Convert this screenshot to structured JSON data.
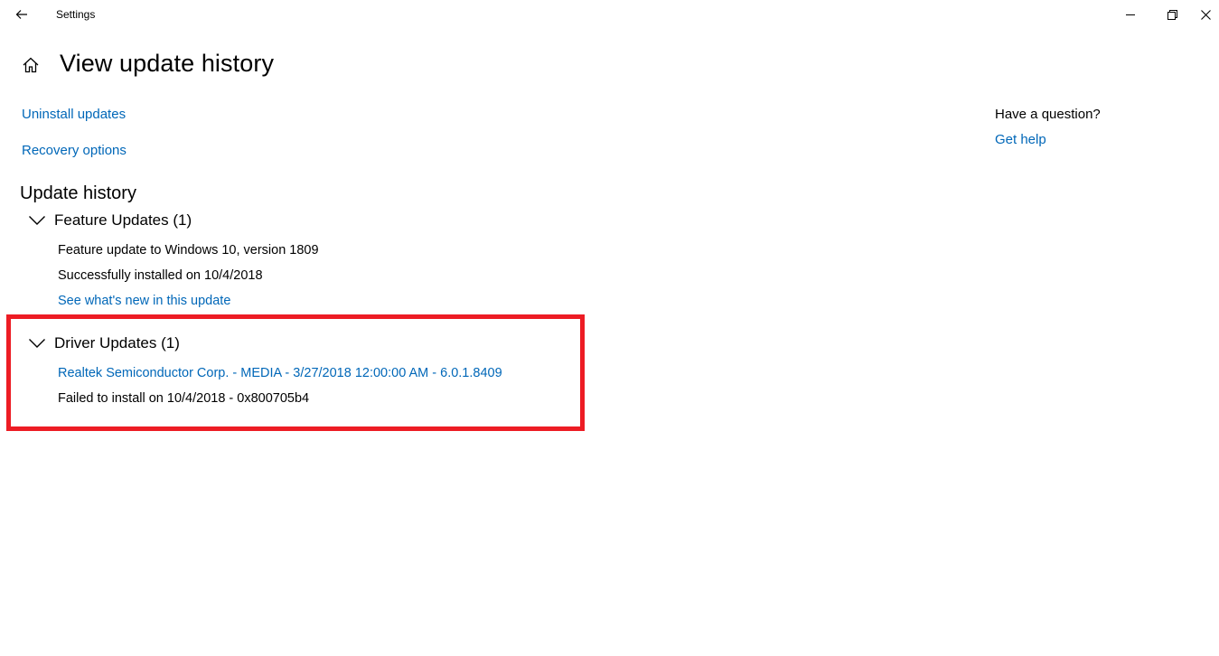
{
  "window": {
    "app_title": "Settings",
    "back_icon": "arrow-left-icon",
    "minimize_icon": "minimize-icon",
    "maximize_icon": "restore-icon",
    "close_icon": "close-icon"
  },
  "header": {
    "home_icon": "home-icon",
    "title": "View update history"
  },
  "links": {
    "uninstall": "Uninstall updates",
    "recovery": "Recovery options"
  },
  "history": {
    "title": "Update history",
    "groups": [
      {
        "label": "Feature Updates (1)",
        "expanded": true,
        "items": [
          {
            "name": "Feature update to Windows 10, version 1809",
            "status": "Successfully installed on 10/4/2018",
            "link": "See what's new in this update"
          }
        ]
      },
      {
        "label": "Driver Updates (1)",
        "expanded": true,
        "items": [
          {
            "name": "Realtek Semiconductor Corp. - MEDIA - 3/27/2018 12:00:00 AM - 6.0.1.8409",
            "status": "Failed to install on 10/4/2018 - 0x800705b4"
          }
        ]
      }
    ]
  },
  "sidebar": {
    "question": "Have a question?",
    "help_link": "Get help"
  },
  "colors": {
    "link": "#0067b8",
    "highlight": "#ed1c24",
    "background": "#ffffff",
    "text": "#000000"
  }
}
